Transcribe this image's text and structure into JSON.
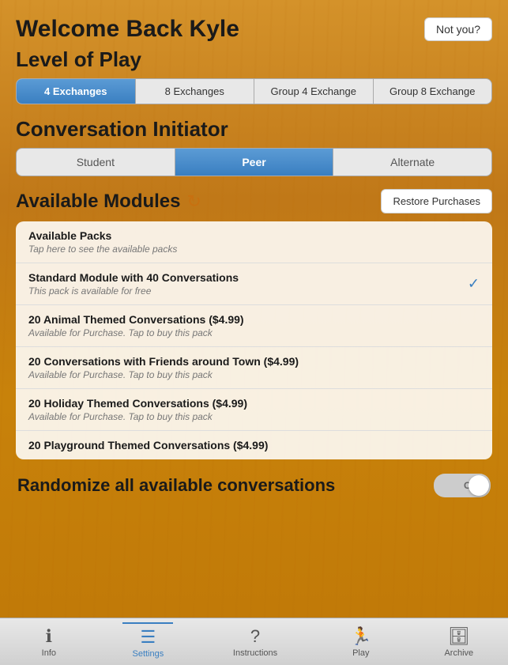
{
  "header": {
    "welcome": "Welcome Back Kyle",
    "not_you_label": "Not you?"
  },
  "level_of_play": {
    "title": "Level of Play",
    "tabs": [
      {
        "label": "4 Exchanges",
        "active": true
      },
      {
        "label": "8 Exchanges",
        "active": false
      },
      {
        "label": "Group 4 Exchange",
        "active": false
      },
      {
        "label": "Group 8 Exchange",
        "active": false
      }
    ]
  },
  "conversation_initiator": {
    "title": "Conversation Initiator",
    "tabs": [
      {
        "label": "Student",
        "active": false
      },
      {
        "label": "Peer",
        "active": true
      },
      {
        "label": "Alternate",
        "active": false
      }
    ]
  },
  "available_modules": {
    "title": "Available Modules",
    "refresh_icon": "↻",
    "restore_button": "Restore Purchases",
    "items": [
      {
        "title": "Available Packs",
        "subtitle": "Tap here to see the available packs",
        "checked": false
      },
      {
        "title": "Standard Module with 40 Conversations",
        "subtitle": "This pack is available for free",
        "checked": true
      },
      {
        "title": "20 Animal Themed Conversations ($4.99)",
        "subtitle": "Available for Purchase. Tap to buy this pack",
        "checked": false
      },
      {
        "title": "20 Conversations with Friends around Town ($4.99)",
        "subtitle": "Available for Purchase. Tap to buy this pack",
        "checked": false
      },
      {
        "title": "20 Holiday Themed Conversations ($4.99)",
        "subtitle": "Available for Purchase. Tap to buy this pack",
        "checked": false
      },
      {
        "title": "20 Playground Themed Conversations ($4.99)",
        "subtitle": "",
        "checked": false
      }
    ]
  },
  "randomize": {
    "label": "Randomize all available conversations",
    "toggle_label": "OFF"
  },
  "bottom_nav": {
    "items": [
      {
        "label": "Info",
        "icon": "ℹ",
        "active": false
      },
      {
        "label": "Settings",
        "icon": "☰",
        "active": true
      },
      {
        "label": "Instructions",
        "icon": "?",
        "active": false
      },
      {
        "label": "Play",
        "icon": "🏃",
        "active": false
      },
      {
        "label": "Archive",
        "icon": "🗄",
        "active": false
      }
    ]
  }
}
